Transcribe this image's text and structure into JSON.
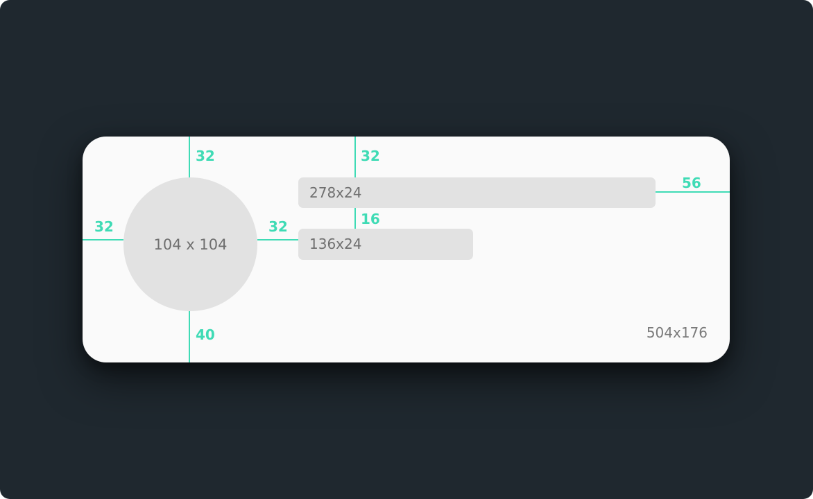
{
  "card": {
    "size_label": "504x176"
  },
  "avatar": {
    "label": "104 x 104"
  },
  "title_placeholder": {
    "label": "278x24"
  },
  "subtitle_placeholder": {
    "label": "136x24"
  },
  "spacing": {
    "avatar_top": "32",
    "avatar_left": "32",
    "avatar_right": "32",
    "avatar_bottom": "40",
    "text_top": "32",
    "text_gap": "16",
    "text_right": "56"
  },
  "colors": {
    "background": "#1f282f",
    "card": "#fafafa",
    "placeholder": "#e2e2e2",
    "measure": "#3fdbb5"
  }
}
